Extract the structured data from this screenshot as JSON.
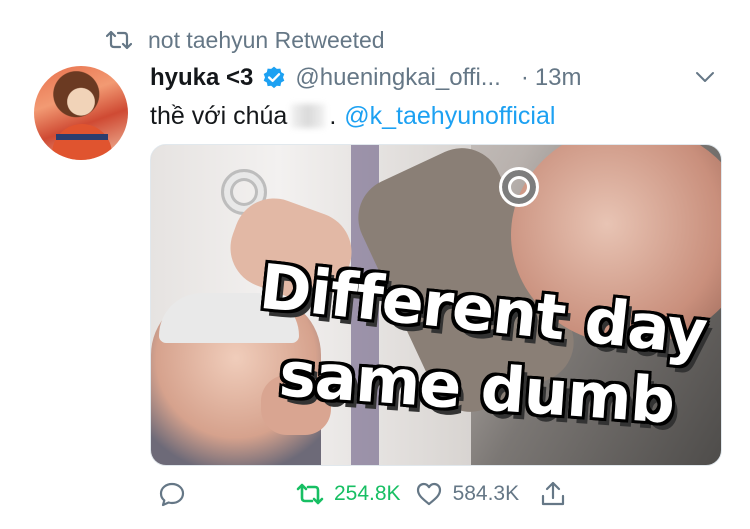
{
  "retweet_context": {
    "icon": "retweet-icon",
    "text": "not taehyun Retweeted"
  },
  "tweet": {
    "author_name": "hyuka <3",
    "verified_icon": "verified-badge-icon",
    "handle": "@hueningkai_offi...",
    "separator": "·",
    "time": "13m",
    "text_before": "thề với chúa",
    "text_after": ".",
    "mention": "@k_taehyunofficial"
  },
  "media": {
    "meme_line1": "Different day",
    "meme_line2": "same dumb"
  },
  "actions": {
    "reply_count": "",
    "retweet_count": "254.8K",
    "like_count": "584.3K"
  },
  "colors": {
    "accent": "#1da1f2",
    "retweet_green": "#17bf63",
    "secondary_text": "#657786",
    "primary_text": "#14171a"
  }
}
